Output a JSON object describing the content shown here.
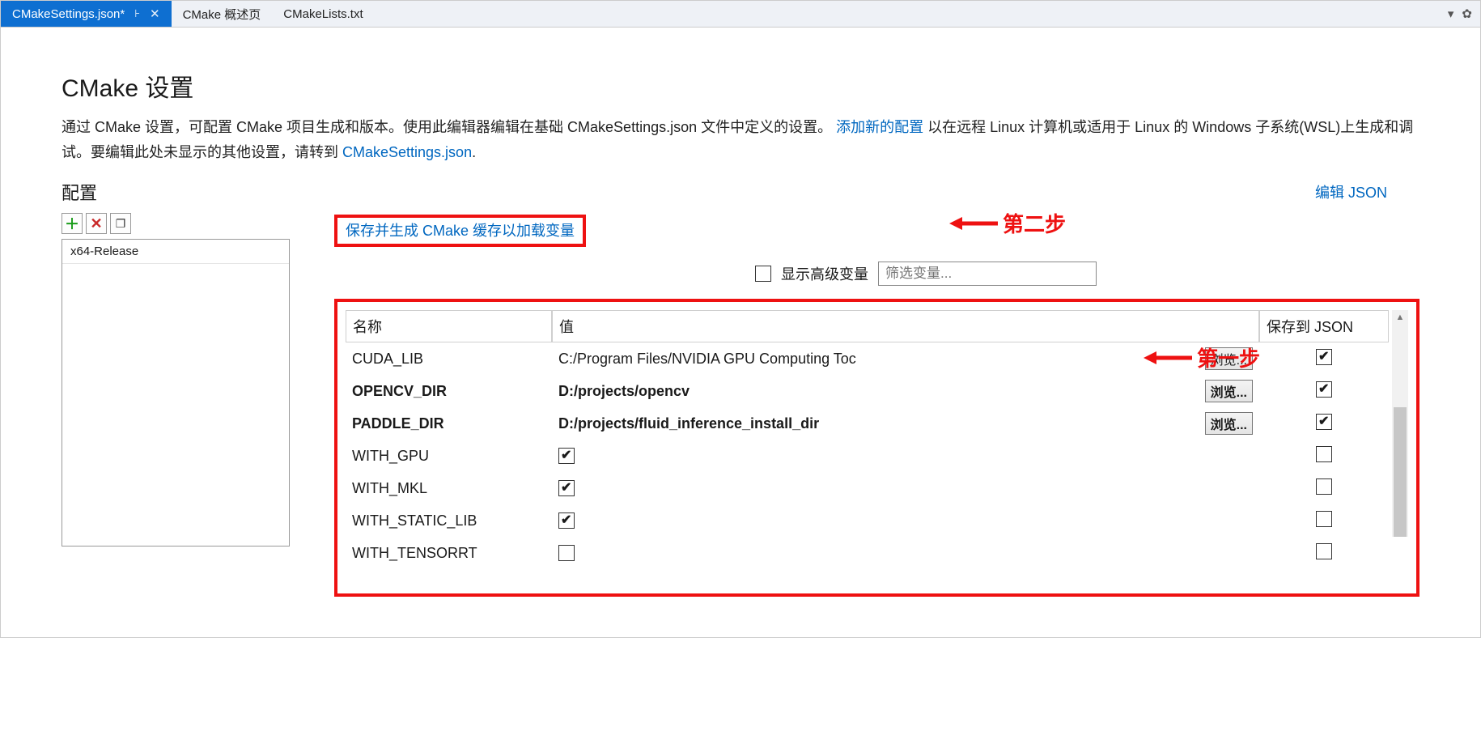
{
  "tabs": {
    "active": "CMakeSettings.json*",
    "t1": "CMake 概述页",
    "t2": "CMakeLists.txt"
  },
  "title": "CMake 设置",
  "desc": {
    "p1a": "通过 CMake 设置，可配置 CMake 项目生成和版本。使用此编辑器编辑在基础 CMakeSettings.json 文件中定义的设置。",
    "addcfg": "添加新的配置",
    "p1b": " 以在远程 Linux 计算机或适用于 Linux 的 Windows 子系统(WSL)上生成和调试。要编辑此处未显示的其他设置，请转到 ",
    "jsonlink": "CMakeSettings.json",
    "dot": "."
  },
  "config_label": "配置",
  "edit_json": "编辑 JSON",
  "list": {
    "item0": "x64-Release"
  },
  "regen_link": "保存并生成 CMake 缓存以加载变量",
  "show_adv": "显示高级变量",
  "filter_placeholder": "筛选变量...",
  "thead": {
    "name": "名称",
    "value": "值",
    "save": "保存到 JSON"
  },
  "browse": "浏览...",
  "rows": [
    {
      "name": "CUDA_LIB",
      "value": "C:/Program Files/NVIDIA GPU Computing Toc",
      "bold": false,
      "has_browse": true,
      "val_checked": false,
      "save_checked": true
    },
    {
      "name": "OPENCV_DIR",
      "value": "D:/projects/opencv",
      "bold": true,
      "has_browse": true,
      "val_checked": false,
      "save_checked": true
    },
    {
      "name": "PADDLE_DIR",
      "value": "D:/projects/fluid_inference_install_dir",
      "bold": true,
      "has_browse": true,
      "val_checked": false,
      "save_checked": true
    },
    {
      "name": "WITH_GPU",
      "value": "",
      "bold": false,
      "has_browse": false,
      "val_checked": true,
      "save_checked": false
    },
    {
      "name": "WITH_MKL",
      "value": "",
      "bold": false,
      "has_browse": false,
      "val_checked": true,
      "save_checked": false
    },
    {
      "name": "WITH_STATIC_LIB",
      "value": "",
      "bold": false,
      "has_browse": false,
      "val_checked": true,
      "save_checked": false
    },
    {
      "name": "WITH_TENSORRT",
      "value": "",
      "bold": false,
      "has_browse": false,
      "val_checked": false,
      "save_checked": false
    }
  ],
  "ann": {
    "step1": "第一步",
    "step2": "第二步"
  }
}
